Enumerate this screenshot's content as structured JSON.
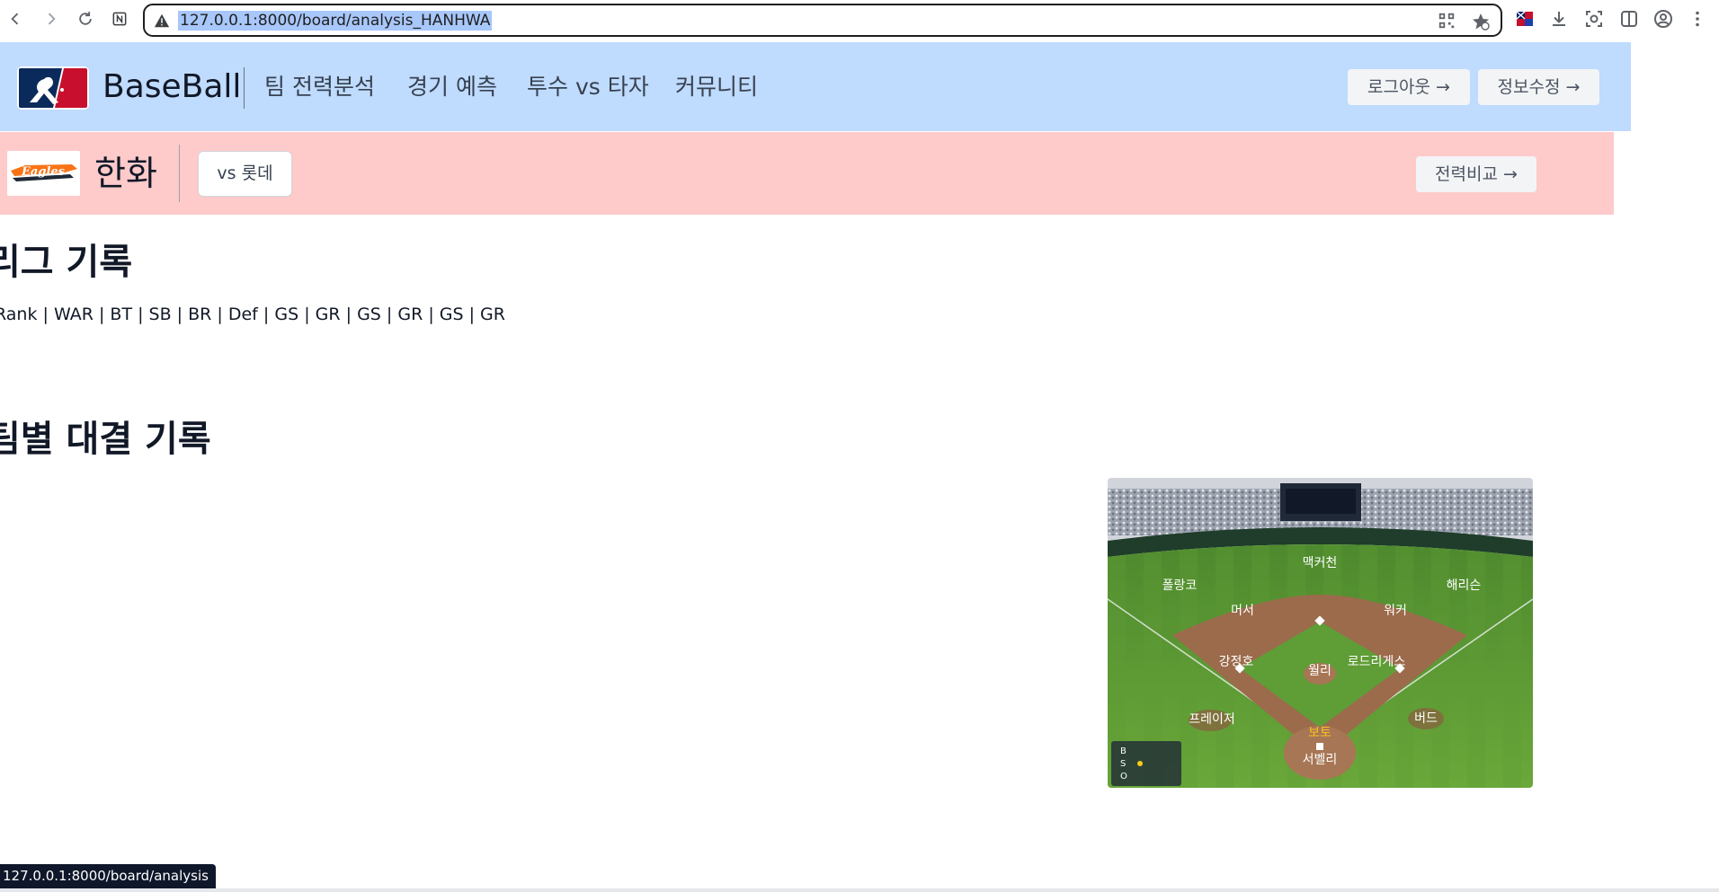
{
  "browser": {
    "url": "127.0.0.1:8000/board/analysis_HANHWA",
    "status_url": "127.0.0.1:8000/board/analysis",
    "nav_icons": [
      "back-icon",
      "forward-icon",
      "reload-icon",
      "notion-icon"
    ],
    "toolbar_icons": [
      "qr-code-icon",
      "bookmark-star-icon",
      "flag-extension-icon",
      "download-icon",
      "screenshot-icon",
      "side-panel-icon",
      "profile-icon",
      "menu-dots-icon"
    ]
  },
  "header": {
    "brand": "BaseBall",
    "logo_icon": "mlb-logo-icon",
    "nav": [
      "팀 전력분석",
      "경기 예측",
      "투수 vs 타자",
      "커뮤니티"
    ],
    "logout_label": "로그아웃 →",
    "edit_profile_label": "정보수정 →",
    "background": "#bfdbfe"
  },
  "team": {
    "name": "한화",
    "logo_icon": "eagles-logo-icon",
    "vs_label": "vs 롯데",
    "compare_label": "전력비교 →",
    "background": "#fecaca"
  },
  "sections": {
    "league_title": "리그 기록",
    "league_stats": [
      "Rank",
      "WAR",
      "BT",
      "SB",
      "BR",
      "Def",
      "GS",
      "GR",
      "GS",
      "GR",
      "GS",
      "GR"
    ],
    "vs_title": "팀별 대결 기록"
  },
  "field": {
    "players": {
      "cf": "맥커천",
      "lf": "폴랑코",
      "rf": "해리슨",
      "ss": "머서",
      "2b": "워커",
      "3b": "강정호",
      "1b": "로드리게스",
      "p": "월리",
      "lf_short": "프레이저",
      "rf_short": "버드",
      "batter": "보토",
      "catcher": "서벨리"
    },
    "count_labels": [
      "B",
      "S",
      "O"
    ]
  }
}
